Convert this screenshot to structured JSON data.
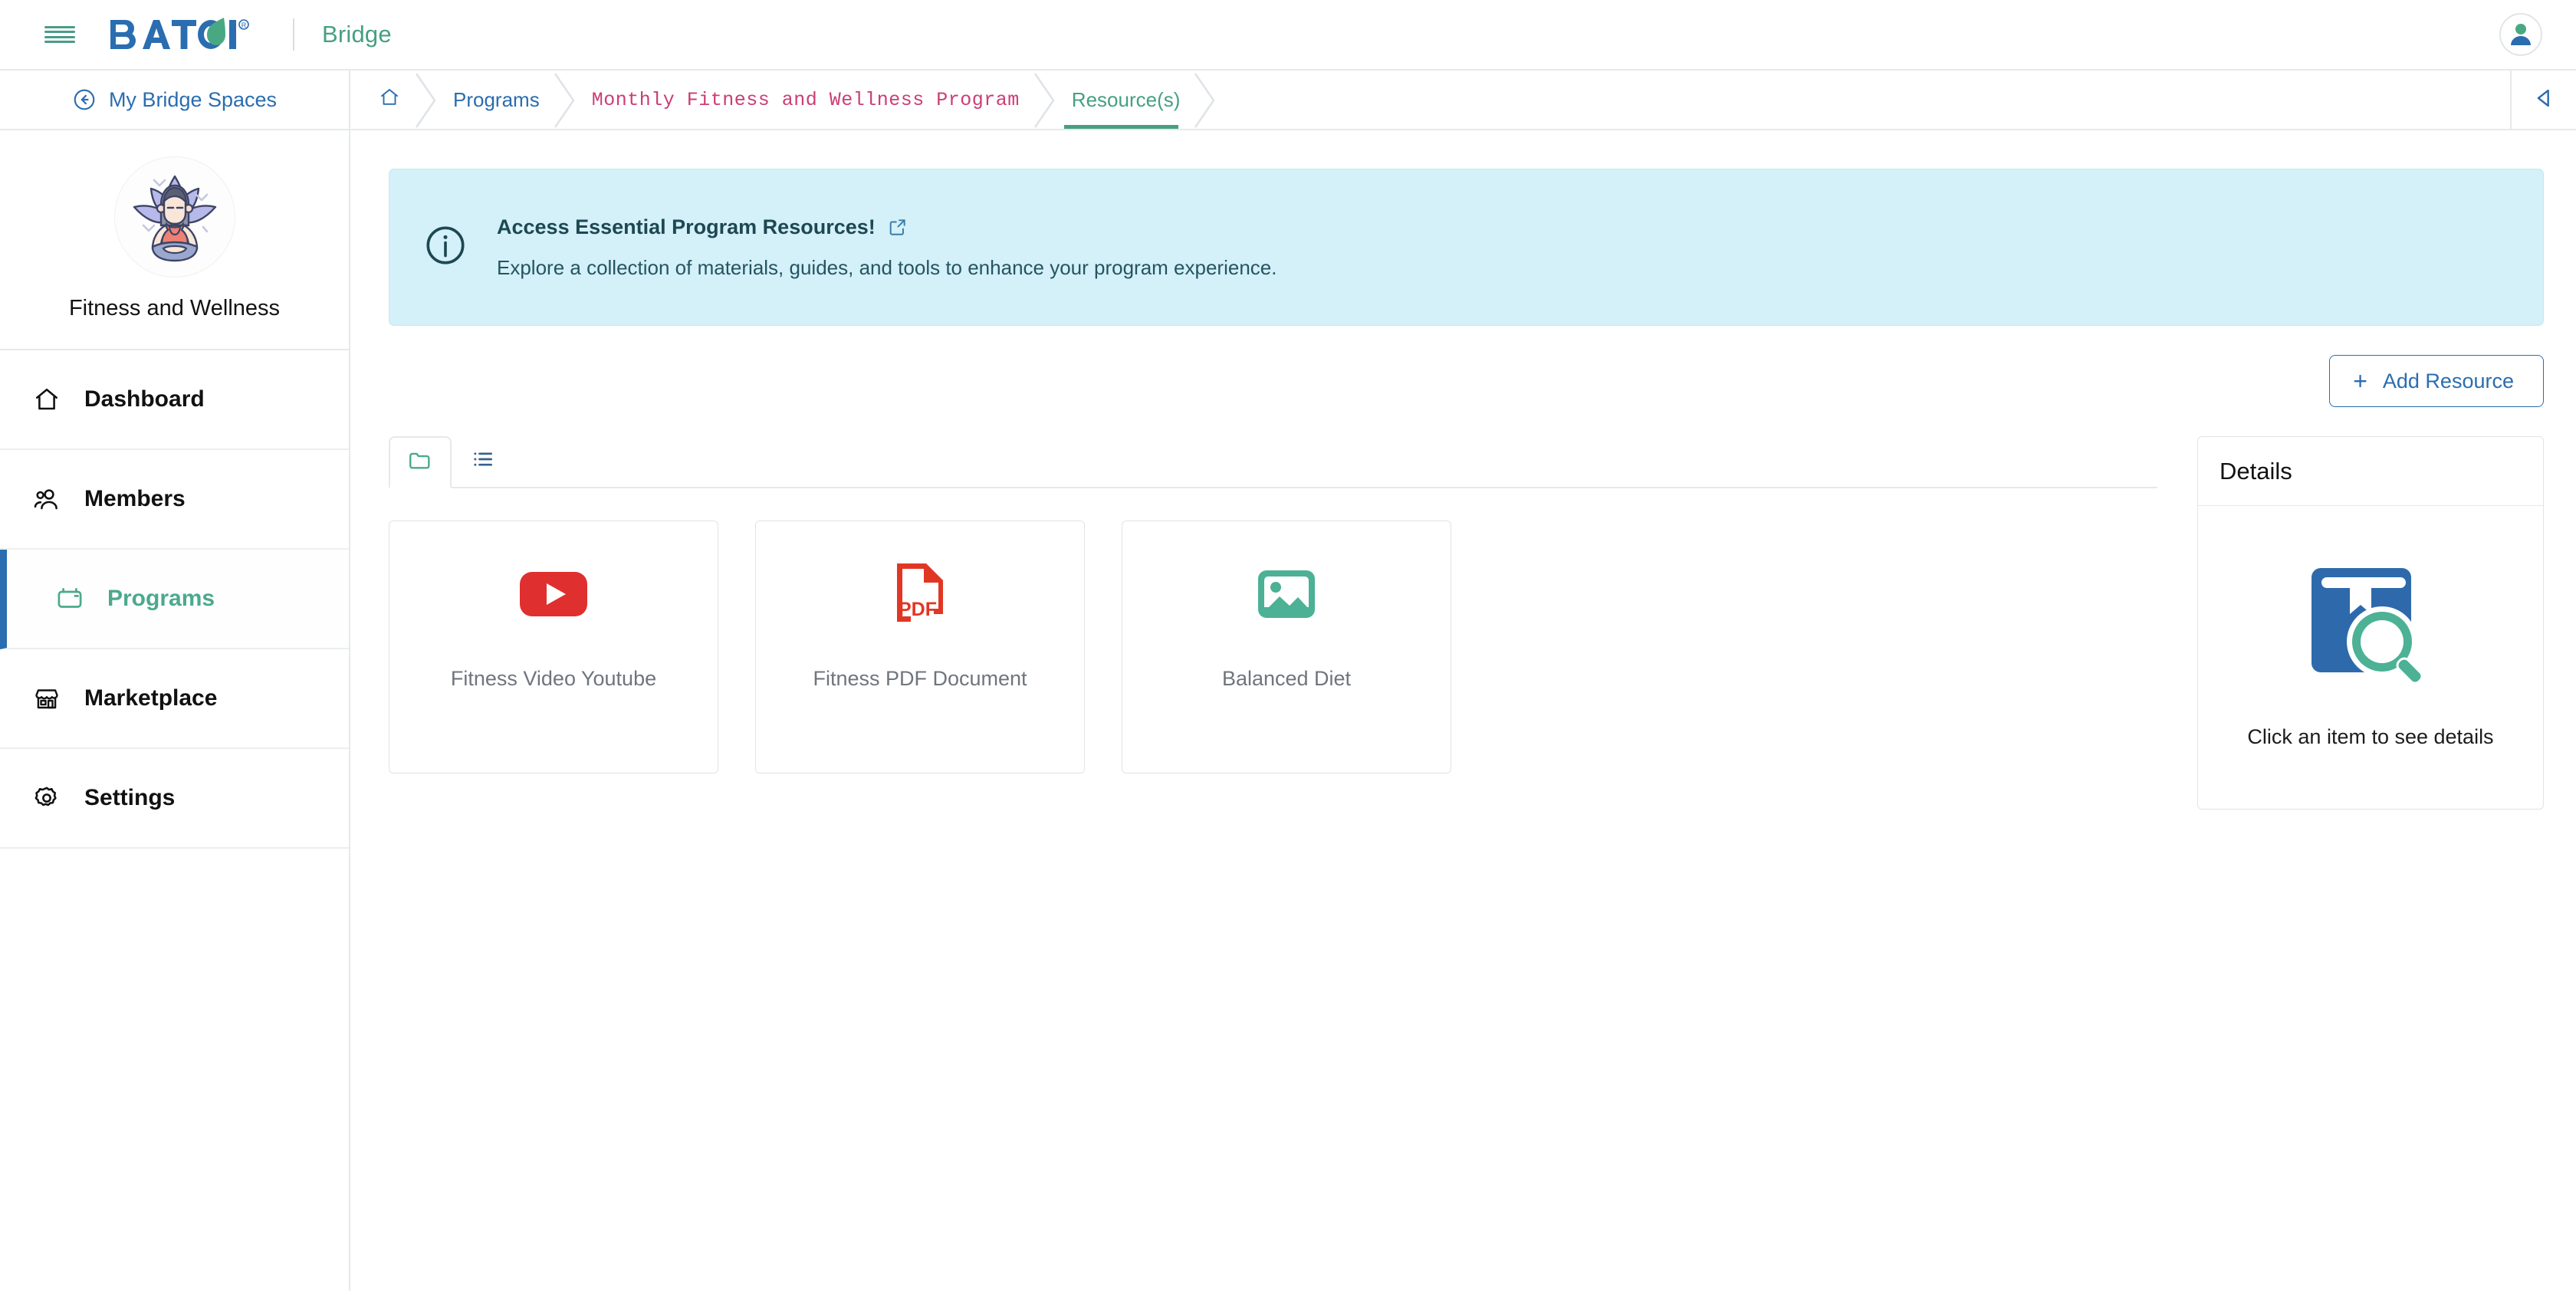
{
  "topbar": {
    "menu_icon": "hamburger-icon",
    "brand_name": "BATOI",
    "brand_registered": "®",
    "app_name": "Bridge",
    "avatar_icon": "user-avatar-icon"
  },
  "crumbbar": {
    "back_label": "My Bridge Spaces",
    "back_icon": "arrow-left-circle-icon",
    "collapse_icon": "chevron-left-icon",
    "crumbs": [
      {
        "label": "",
        "icon": "home-icon",
        "style": "home"
      },
      {
        "label": "Programs",
        "icon": "",
        "style": "link"
      },
      {
        "label": "Monthly Fitness and Wellness Program",
        "icon": "",
        "style": "program"
      },
      {
        "label": "Resource(s)",
        "icon": "",
        "style": "active"
      }
    ]
  },
  "sidebar": {
    "space_name": "Fitness and Wellness",
    "space_avatar_icon": "yoga-lotus-avatar",
    "items": [
      {
        "label": "Dashboard",
        "icon": "home-icon",
        "active": false
      },
      {
        "label": "Members",
        "icon": "users-icon",
        "active": false
      },
      {
        "label": "Programs",
        "icon": "calendar-folder-icon",
        "active": true
      },
      {
        "label": "Marketplace",
        "icon": "store-icon",
        "active": false
      },
      {
        "label": "Settings",
        "icon": "gear-icon",
        "active": false
      }
    ]
  },
  "info_banner": {
    "icon": "info-circle-icon",
    "title": "Access Essential Program Resources!",
    "link_icon": "external-link-icon",
    "description": "Explore a collection of materials, guides, and tools to enhance your program experience.",
    "bg_color": "#d4f0f8"
  },
  "toolbar": {
    "add_resource_label": "Add Resource",
    "add_icon": "plus-icon"
  },
  "view_tabs": [
    {
      "icon": "folder-icon",
      "active": true,
      "color": "#4ca98c"
    },
    {
      "icon": "list-icon",
      "active": false,
      "color": "#2a6db0"
    }
  ],
  "resources": [
    {
      "name": "Fitness Video Youtube",
      "icon": "youtube-icon",
      "color": "#e02f2f"
    },
    {
      "name": "Fitness PDF Document",
      "icon": "pdf-file-icon",
      "color": "#e03724"
    },
    {
      "name": "Balanced Diet",
      "icon": "image-icon",
      "color": "#4cb195"
    }
  ],
  "details": {
    "title": "Details",
    "empty_icon": "book-search-icon",
    "empty_text": "Click an item to see details"
  },
  "colors": {
    "brand_blue": "#2a6db0",
    "brand_green": "#46a07f",
    "crumb_pink": "#cb3d74",
    "border": "#e6e9ec"
  }
}
